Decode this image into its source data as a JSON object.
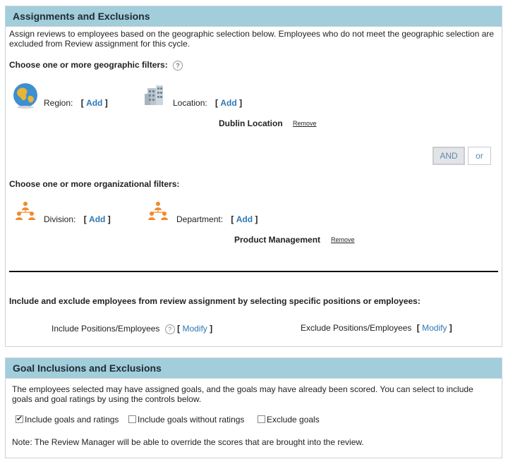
{
  "assignments": {
    "title": "Assignments and Exclusions",
    "description": "Assign reviews to employees based on the geographic selection below. Employees who do not meet the geographic selection are excluded from Review assignment for this cycle.",
    "geo_heading": "Choose one or more geographic filters:",
    "help_glyph": "?",
    "region_label": "Region:",
    "location_label": "Location:",
    "add_label": "Add",
    "bracket_open": "[",
    "bracket_close": "]",
    "location_value": "Dublin Location",
    "remove_label": "Remove",
    "and_label": "AND",
    "or_label": "or",
    "org_heading": "Choose one or more organizational filters:",
    "division_label": "Division:",
    "department_label": "Department:",
    "department_value": "Product Management",
    "include_exclude_heading": "Include and exclude employees from review assignment by selecting specific positions or employees:",
    "include_label": "Include Positions/Employees",
    "exclude_label": "Exclude Positions/Employees",
    "modify_label": "Modify"
  },
  "goals": {
    "title": "Goal Inclusions and Exclusions",
    "description": "The employees selected may have assigned goals, and the goals may have already been scored. You can select to include goals and goal ratings by using the controls below.",
    "options": [
      {
        "label": "Include goals and ratings",
        "checked": true
      },
      {
        "label": "Include goals without ratings",
        "checked": false
      },
      {
        "label": "Exclude goals",
        "checked": false
      }
    ],
    "note": "Note: The Review Manager will be able to override the scores that are brought into the review."
  }
}
